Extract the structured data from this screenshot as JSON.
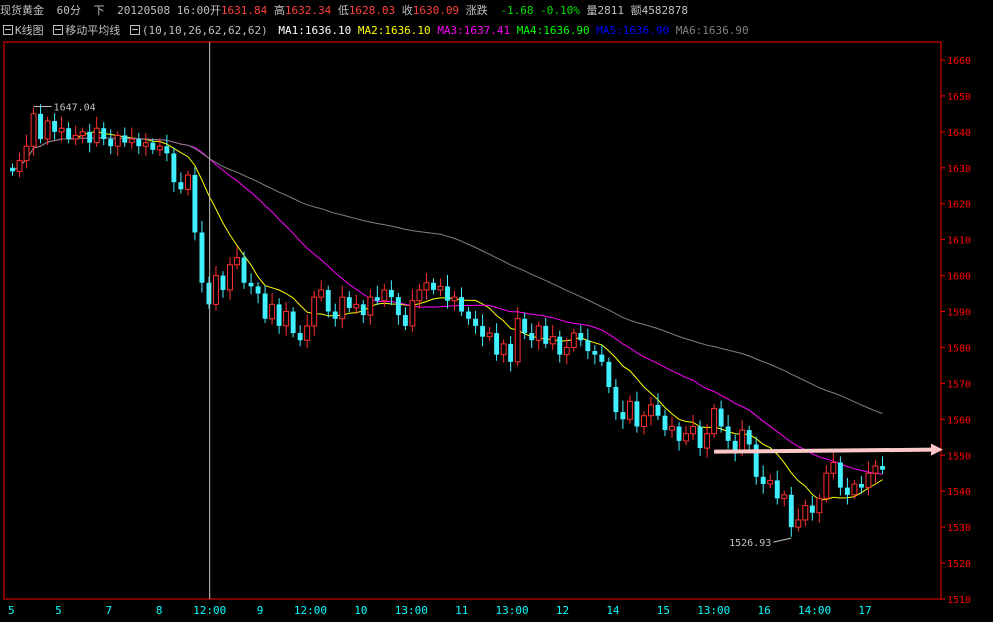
{
  "header": {
    "symbol": "现货黄金",
    "period": "60分",
    "direction": "下",
    "datetime": "20120508 16:00",
    "open_label": "开",
    "open": "1631.84",
    "high_label": "高",
    "high": "1632.34",
    "low_label": "低",
    "low": "1628.03",
    "close_label": "收",
    "close": "1630.09",
    "change_label": "涨跌",
    "change": "-1.68",
    "change_pct": "-0.10%",
    "volume_label": "量",
    "volume": "2811",
    "amount_label": "额",
    "amount": "4582878"
  },
  "ma_bar": {
    "kline_label": "K线图",
    "indicator_label": "移动平均线",
    "params": "(10,10,26,62,62,62)",
    "ma1": "MA1:1636.10",
    "ma2": "MA2:1636.10",
    "ma3": "MA3:1637.41",
    "ma4": "MA4:1636.90",
    "ma5": "MA5:1636.90",
    "ma6": "MA6:1636.90"
  },
  "colors": {
    "up": "#ff3030",
    "down": "#40f0ff",
    "ma1": "#ffffff",
    "ma2": "#ffff00",
    "ma3": "#ff00ff",
    "ma4": "#00ff00",
    "ma5": "#0000ff",
    "ma6": "#808080",
    "axis": "#ff0000",
    "arrow": "#ffc8c8"
  },
  "chart_data": {
    "type": "candlestick",
    "ylim": [
      1510,
      1665
    ],
    "y_ticks": [
      "1660",
      "1650",
      "1640",
      "1630",
      "1620",
      "1610",
      "1600",
      "1590",
      "1580",
      "1570",
      "1560",
      "1550",
      "1540",
      "1530",
      "1520",
      "1510"
    ],
    "x_labels": [
      "5",
      "5",
      "7",
      "8",
      "12:00",
      "9",
      "12:00",
      "10",
      "13:00",
      "11",
      "13:00",
      "12",
      "14",
      "15",
      "13:00",
      "16",
      "14:00",
      "17"
    ],
    "annotations": {
      "high_label": "1647.04",
      "low_label": "1526.93"
    },
    "closes": [
      1629,
      1632,
      1636,
      1645,
      1638,
      1643,
      1640,
      1641,
      1638,
      1639,
      1640,
      1637,
      1641,
      1638,
      1636,
      1639,
      1637,
      1638,
      1636,
      1637,
      1635,
      1636,
      1634,
      1626,
      1624,
      1628,
      1612,
      1598,
      1592,
      1600,
      1596,
      1603,
      1605,
      1598,
      1597,
      1595,
      1588,
      1592,
      1586,
      1590,
      1584,
      1582,
      1586,
      1594,
      1596,
      1590,
      1588,
      1594,
      1591,
      1592,
      1589,
      1594,
      1593,
      1596,
      1594,
      1589,
      1586,
      1593,
      1596,
      1598,
      1596,
      1597,
      1593,
      1594,
      1590,
      1588,
      1586,
      1583,
      1584,
      1578,
      1581,
      1576,
      1588,
      1584,
      1582,
      1586,
      1581,
      1583,
      1578,
      1580,
      1584,
      1582,
      1579,
      1578,
      1576,
      1569,
      1562,
      1560,
      1565,
      1558,
      1561,
      1564,
      1561,
      1557,
      1558,
      1554,
      1556,
      1558,
      1552,
      1556,
      1563,
      1558,
      1554,
      1551,
      1557,
      1553,
      1544,
      1542,
      1543,
      1538,
      1539,
      1530,
      1532,
      1536,
      1534,
      1538,
      1545,
      1548,
      1541,
      1539,
      1542,
      1541,
      1545,
      1547,
      1546
    ]
  }
}
